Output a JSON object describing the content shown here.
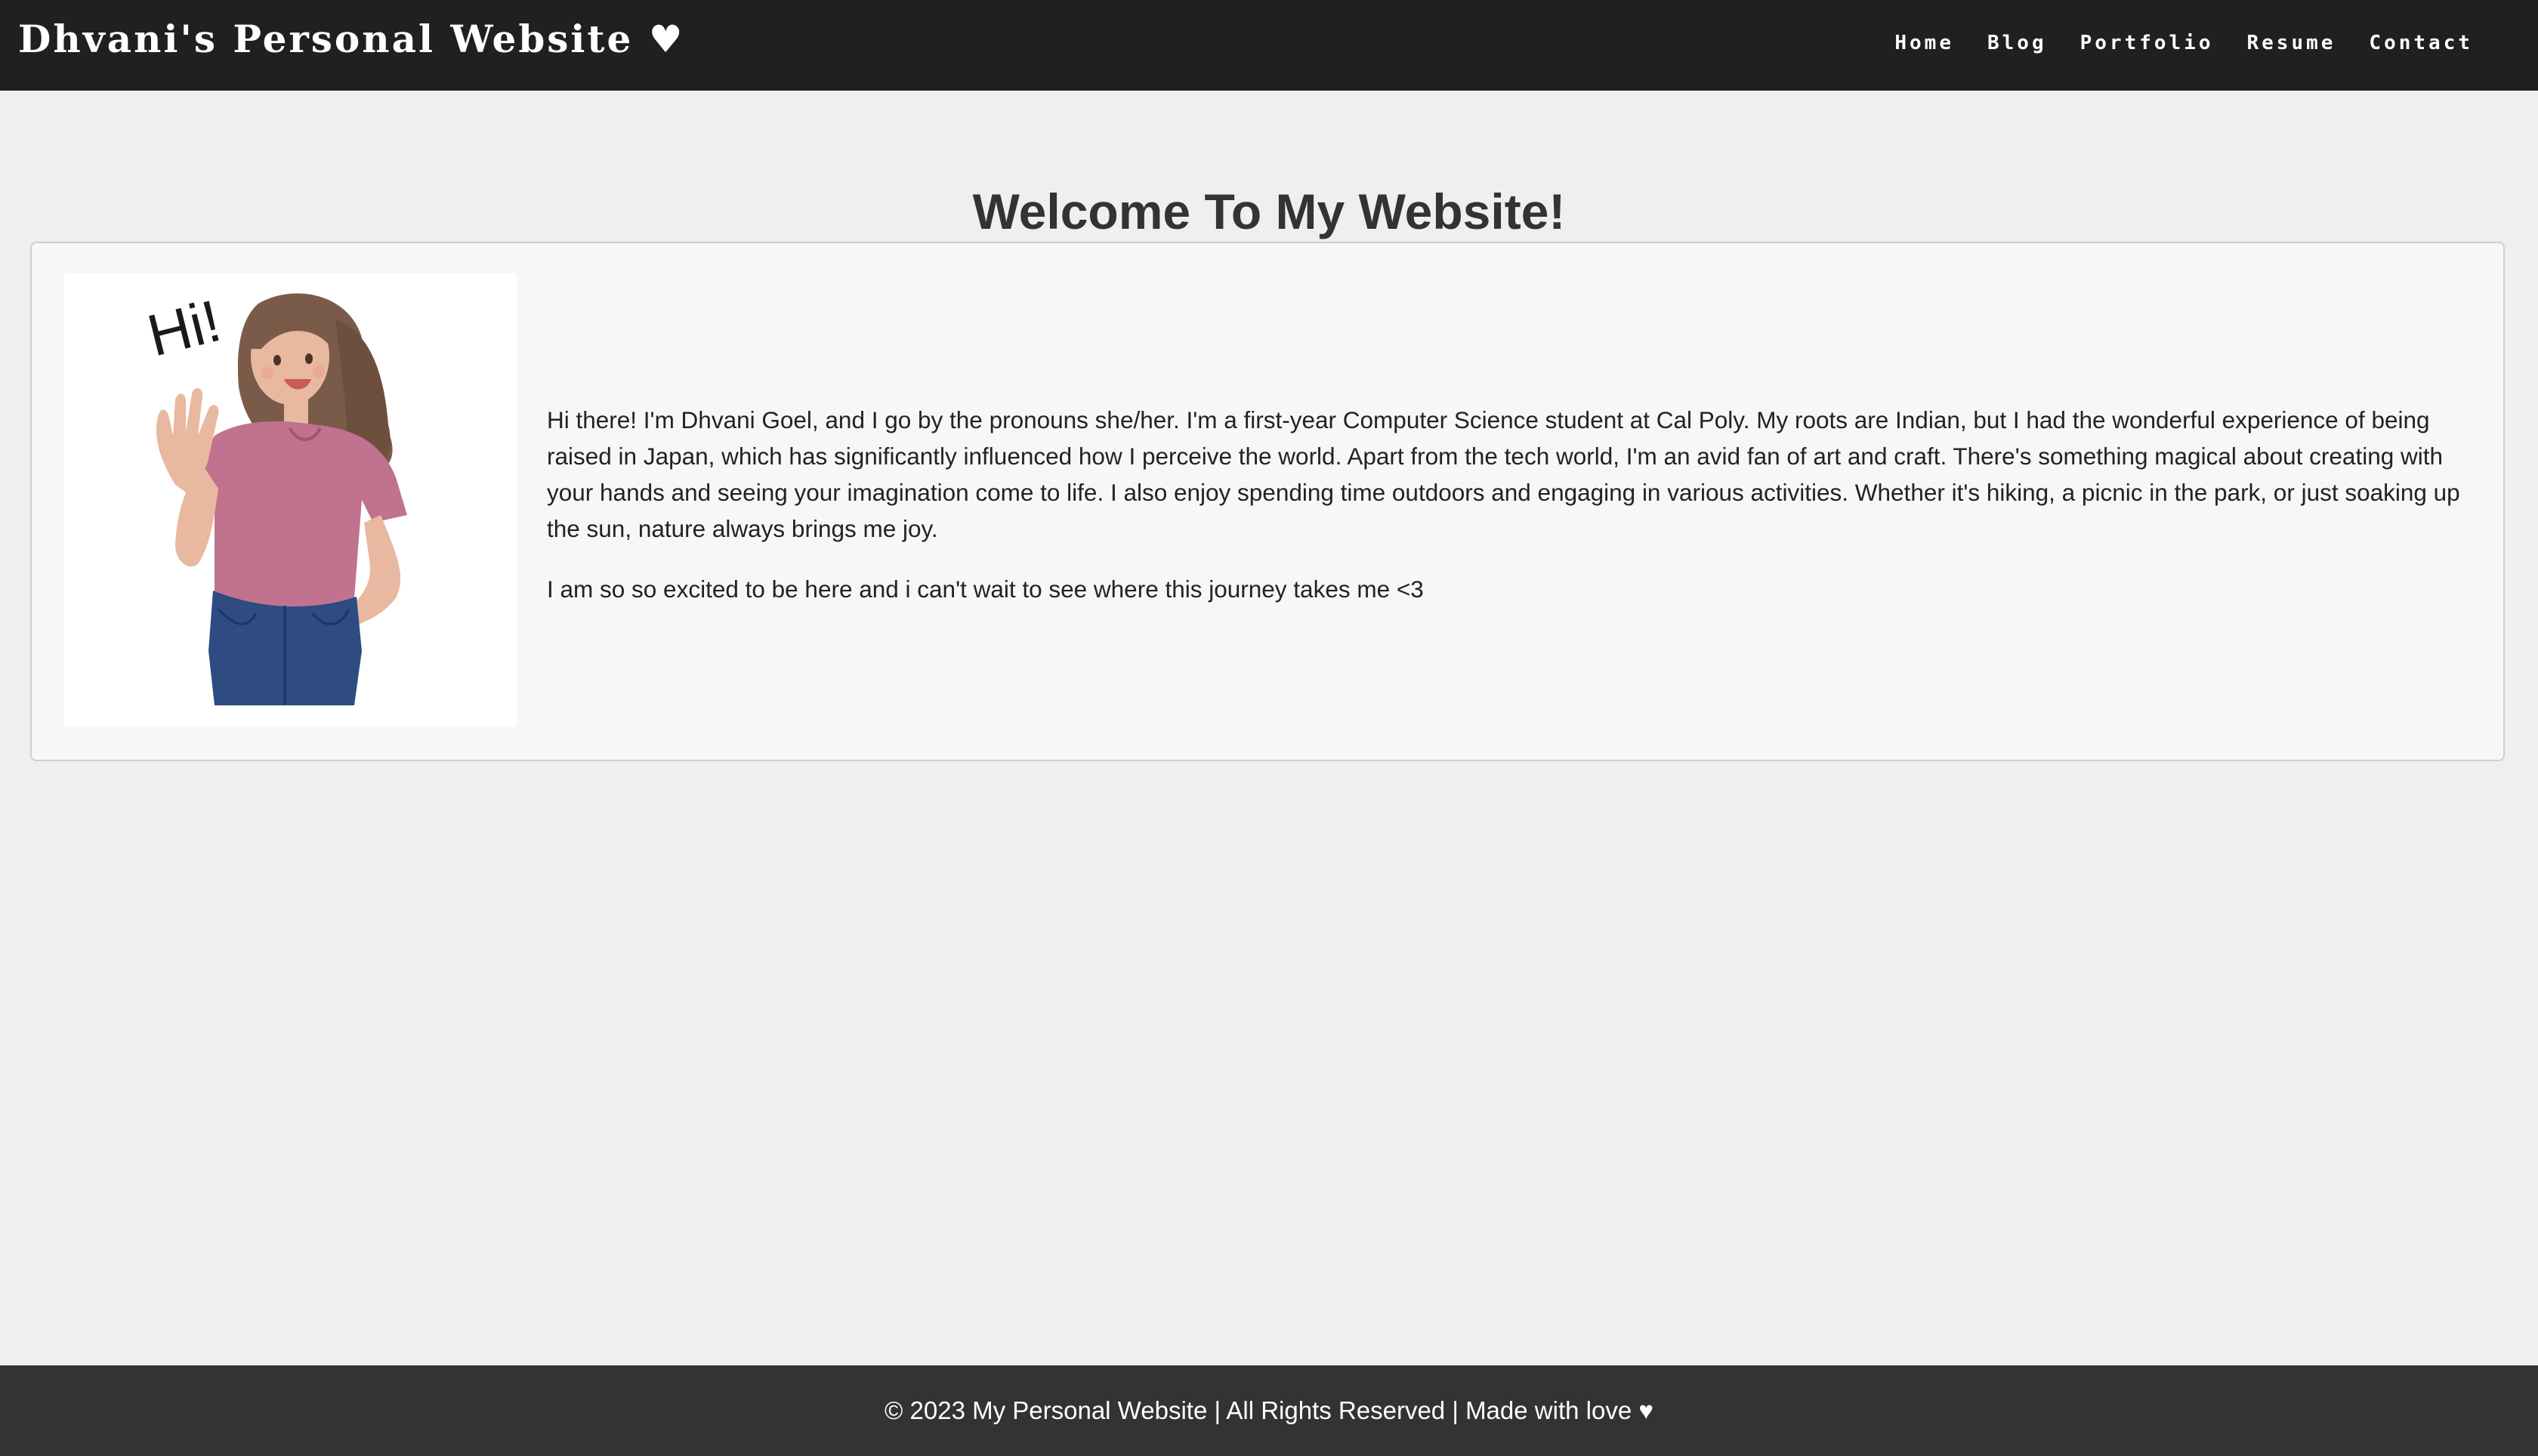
{
  "header": {
    "site_title": "Dhvani's Personal Website ♥",
    "nav": [
      "Home",
      "Blog",
      "Portfolio",
      "Resume",
      "Contact"
    ]
  },
  "main": {
    "heading": "Welcome To My Website!",
    "avatar": {
      "greeting": "Hi!",
      "icon": "waving-girl-illustration"
    },
    "bio_paragraphs": [
      "Hi there! I'm Dhvani Goel, and I go by the pronouns she/her. I'm a first-year Computer Science student at Cal Poly. My roots are Indian, but I had the wonderful experience of being raised in Japan, which has significantly influenced how I perceive the world. Apart from the tech world, I'm an avid fan of art and craft. There's something magical about creating with your hands and seeing your imagination come to life. I also enjoy spending time outdoors and engaging in various activities. Whether it's hiking, a picnic in the park, or just soaking up the sun, nature always brings me joy.",
      "I am so so excited to be here and i can't wait to see where this journey takes me <3"
    ]
  },
  "footer": {
    "text": "© 2023 My Personal Website | All Rights Reserved | Made with love ♥"
  },
  "colors": {
    "header_bg": "#1f2020",
    "page_bg": "#efefef",
    "card_bg": "#f7f7f7",
    "footer_bg": "#333333",
    "shirt": "#c0728f",
    "jeans": "#2e4b82",
    "hair": "#7a5a48"
  }
}
